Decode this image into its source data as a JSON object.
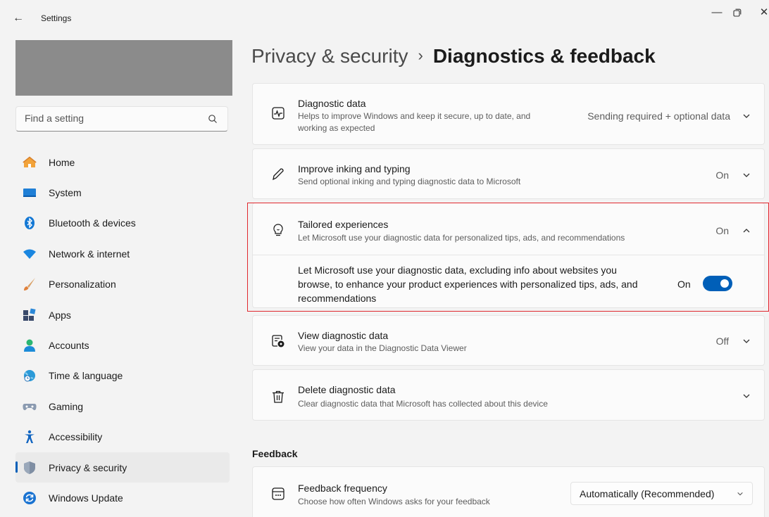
{
  "window": {
    "title": "Settings",
    "back_icon": "back-arrow-icon",
    "controls": [
      "minimize-icon",
      "restore-icon",
      "close-icon"
    ]
  },
  "search": {
    "placeholder": "Find a setting"
  },
  "sidebar": {
    "items": [
      {
        "label": "Home",
        "icon": "home-icon",
        "active": false
      },
      {
        "label": "System",
        "icon": "system-icon",
        "active": false
      },
      {
        "label": "Bluetooth & devices",
        "icon": "bluetooth-icon",
        "active": false
      },
      {
        "label": "Network & internet",
        "icon": "network-icon",
        "active": false
      },
      {
        "label": "Personalization",
        "icon": "brush-icon",
        "active": false
      },
      {
        "label": "Apps",
        "icon": "apps-icon",
        "active": false
      },
      {
        "label": "Accounts",
        "icon": "accounts-icon",
        "active": false
      },
      {
        "label": "Time & language",
        "icon": "globe-clock-icon",
        "active": false
      },
      {
        "label": "Gaming",
        "icon": "gamepad-icon",
        "active": false
      },
      {
        "label": "Accessibility",
        "icon": "accessibility-icon",
        "active": false
      },
      {
        "label": "Privacy & security",
        "icon": "shield-icon",
        "active": true
      },
      {
        "label": "Windows Update",
        "icon": "update-icon",
        "active": false
      }
    ]
  },
  "breadcrumb": {
    "parent": "Privacy & security",
    "separator": "›",
    "current": "Diagnostics & feedback"
  },
  "cards": {
    "diagnostic_data": {
      "title": "Diagnostic data",
      "subtitle_line1": "Helps to improve Windows and keep it secure, up to date, and",
      "subtitle_line2": "working as expected",
      "value": "Sending required + optional data"
    },
    "inking": {
      "title": "Improve inking and typing",
      "subtitle": "Send optional inking and typing diagnostic data to Microsoft",
      "value": "On"
    },
    "tailored": {
      "title": "Tailored experiences",
      "subtitle": "Let Microsoft use your diagnostic data for personalized tips, ads, and recommendations",
      "value": "On",
      "expanded_line1": "Let Microsoft use your diagnostic data, excluding info about websites you",
      "expanded_line2": "browse, to enhance your product experiences with personalized tips, ads, and",
      "expanded_line3": "recommendations",
      "toggle_label": "On",
      "toggle_on": true
    },
    "view_data": {
      "title": "View diagnostic data",
      "subtitle": "View your data in the Diagnostic Data Viewer",
      "value": "Off"
    },
    "delete_data": {
      "title": "Delete diagnostic data",
      "subtitle": "Clear diagnostic data that Microsoft has collected about this device"
    }
  },
  "feedback_section": {
    "heading": "Feedback",
    "frequency": {
      "title": "Feedback frequency",
      "subtitle": "Choose how often Windows asks for your feedback",
      "selected": "Automatically (Recommended)"
    }
  },
  "colors": {
    "accent": "#005fb8",
    "highlight": "#e0282e",
    "background": "#f3f3f3"
  }
}
